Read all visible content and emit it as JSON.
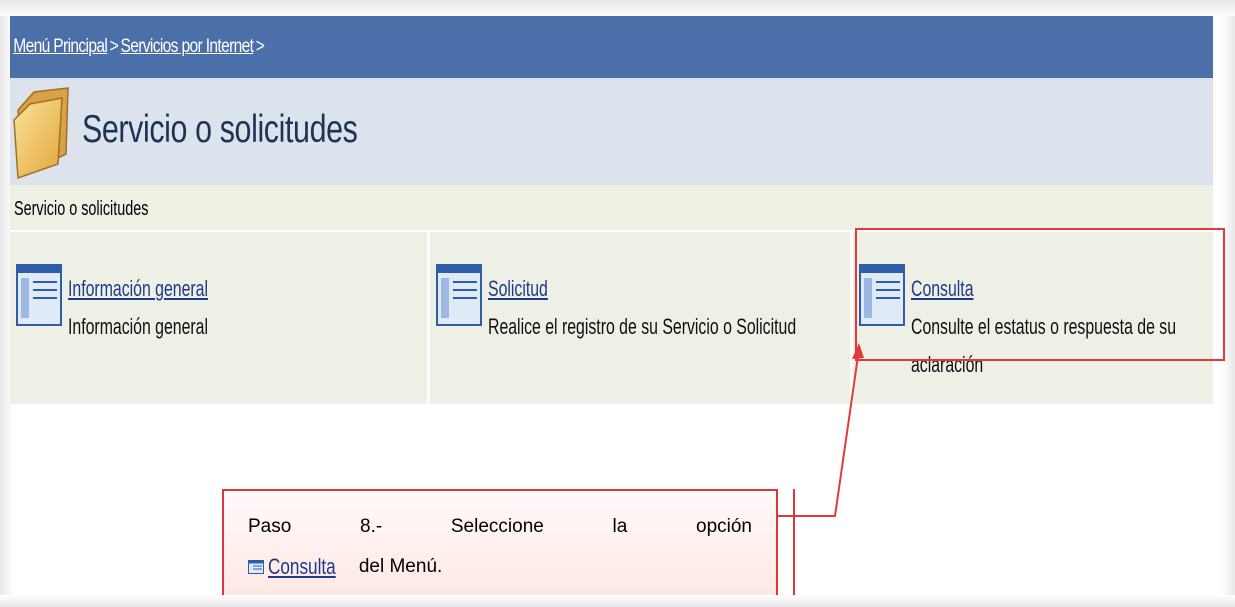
{
  "breadcrumb": {
    "items": [
      "Menú Principal",
      "Servicios por Internet"
    ],
    "separator": ">"
  },
  "page": {
    "title": "Servicio o solicitudes",
    "section_label": "Servicio o solicitudes"
  },
  "tiles": [
    {
      "link": "Información general",
      "description": "Información general"
    },
    {
      "link": "Solicitud",
      "description": "Realice el registro de su Servicio o Solicitud"
    },
    {
      "link": "Consulta",
      "description": "Consulte el estatus o respuesta de su aclaración"
    }
  ],
  "annotation": {
    "words": [
      "Paso",
      "8.-",
      "Seleccione",
      "la",
      "opción"
    ],
    "link": "Consulta",
    "suffix": "del Menú."
  },
  "colors": {
    "header_blue": "#4a6fa9",
    "title_band": "#dde3ec",
    "tile_bg": "#eef0e6",
    "highlight_red": "#e23a3a",
    "link_blue": "#1d3a8a"
  },
  "icons": [
    "folder-icon",
    "page-icon",
    "arrow-icon"
  ]
}
